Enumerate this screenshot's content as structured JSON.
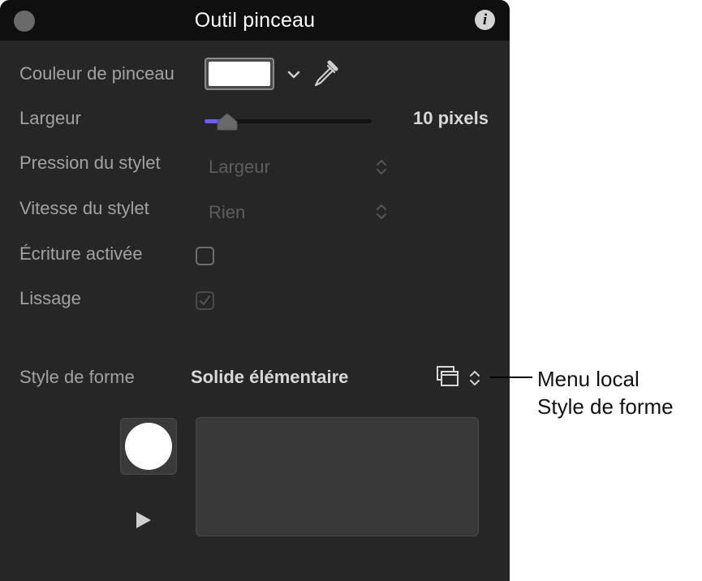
{
  "window": {
    "title": "Outil pinceau",
    "info_icon": "info-icon"
  },
  "fields": {
    "brush_color_label": "Couleur de pinceau",
    "brush_color_value": "#ffffff",
    "width_label": "Largeur",
    "width_value": "10 pixels",
    "width_slider_level": 0.1,
    "stylus_pressure_label": "Pression du stylet",
    "stylus_pressure_value": "Largeur",
    "stylus_speed_label": "Vitesse du stylet",
    "stylus_speed_value": "Rien",
    "write_on_label": "Écriture activée",
    "write_on_checked": false,
    "smoothing_label": "Lissage",
    "smoothing_checked": true,
    "shape_style_label": "Style de forme",
    "shape_style_value": "Solide élémentaire"
  },
  "callout": {
    "line1": "Menu local",
    "line2": "Style de forme"
  },
  "colors": {
    "panel_bg": "#262626",
    "titlebar_bg": "#0f0f0f",
    "slider_accent": "#6f5cff"
  }
}
